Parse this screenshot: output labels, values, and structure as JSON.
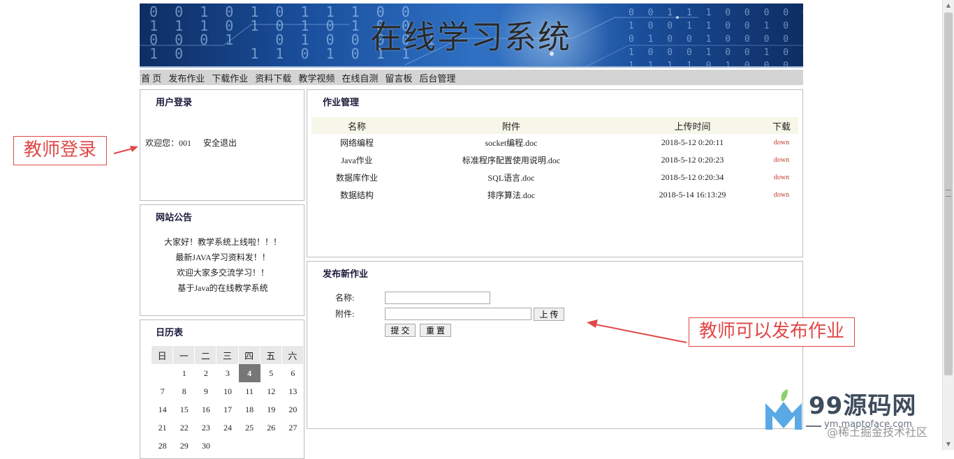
{
  "site": {
    "title": "在线学习系统"
  },
  "nav": {
    "items": [
      "首 页",
      "发布作业",
      "下载作业",
      "资料下载",
      "教学视频",
      "在线自测",
      "留言板",
      "后台管理"
    ]
  },
  "login": {
    "title": "用户登录",
    "welcome": "欢迎您：001",
    "logout": "安全退出"
  },
  "notice": {
    "title": "网站公告",
    "items": [
      "大家好！教学系统上线啦！！！",
      "最新JAVA学习资料发！！",
      "欢迎大家多交流学习！！",
      "基于Java的在线教学系统"
    ]
  },
  "calendar": {
    "title": "日历表",
    "weekdays": [
      "日",
      "一",
      "二",
      "三",
      "四",
      "五",
      "六"
    ],
    "today": "4",
    "weeks": [
      [
        "",
        "1",
        "2",
        "3",
        "4",
        "5",
        "6"
      ],
      [
        "7",
        "8",
        "9",
        "10",
        "11",
        "12",
        "13"
      ],
      [
        "14",
        "15",
        "16",
        "17",
        "18",
        "19",
        "20"
      ],
      [
        "21",
        "22",
        "23",
        "24",
        "25",
        "26",
        "27"
      ],
      [
        "28",
        "29",
        "30",
        "",
        "",
        "",
        ""
      ]
    ]
  },
  "homework": {
    "title": "作业管理",
    "columns": [
      "名称",
      "附件",
      "上传时间",
      "下载"
    ],
    "rows": [
      {
        "name": "网络编程",
        "file": "socket编程.doc",
        "time": "2018-5-12 0:20:11",
        "link": "down"
      },
      {
        "name": "Java作业",
        "file": "标准程序配置使用说明.doc",
        "time": "2018-5-12 0:20:23",
        "link": "down"
      },
      {
        "name": "数据库作业",
        "file": "SQL语言.doc",
        "time": "2018-5-12 0:20:34",
        "link": "down"
      },
      {
        "name": "数据结构",
        "file": "排序算法.doc",
        "time": "2018-5-14 16:13:29",
        "link": "down"
      }
    ]
  },
  "publish": {
    "title": "发布新作业",
    "name_label": "名称:",
    "file_label": "附件:",
    "name_value": "",
    "file_value": "",
    "upload_label": "上 传",
    "submit_label": "提 交",
    "reset_label": "重 置"
  },
  "annotations": {
    "login_note": "教师登录",
    "publish_note": "教师可以发布作业"
  },
  "watermark": {
    "brand": "99源码网",
    "url": "ym.maptoface.com",
    "community": "@稀土掘金技术社区"
  },
  "colors": {
    "annotation": "#e04848",
    "nav_bg": "#d4d4d4",
    "down_link": "#c0392b",
    "banner": "#1a4f9c"
  }
}
